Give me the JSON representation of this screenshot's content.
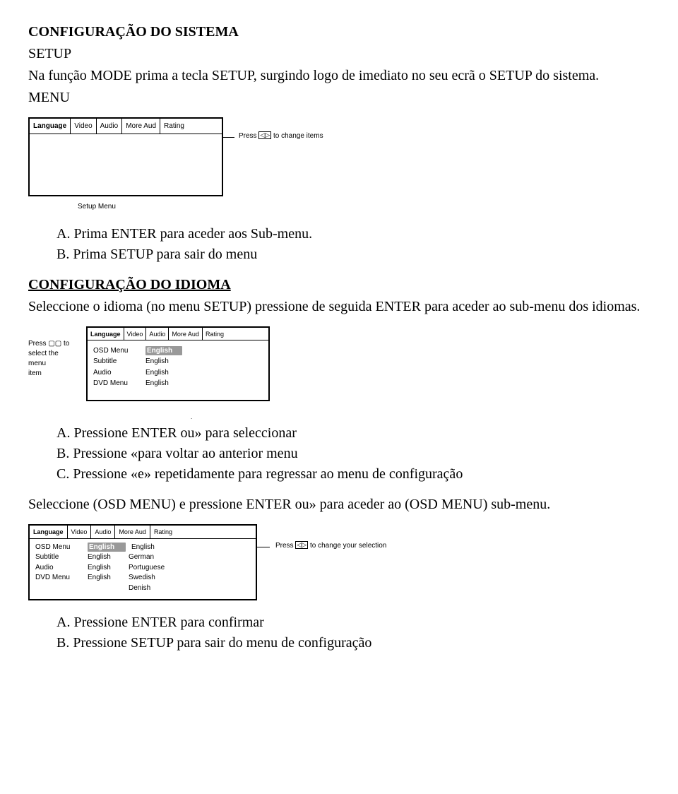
{
  "h1": "CONFIGURAÇÃO DO SISTEMA",
  "setup_line": "SETUP",
  "intro": "Na função MODE prima a tecla SETUP, surgindo logo de imediato no seu ecrã o SETUP do sistema.",
  "menu_label": "MENU",
  "menu1": {
    "tabs": [
      "Language",
      "Video",
      "Audio",
      "More Aud",
      "Rating"
    ],
    "instruction_prefix": "Press",
    "instruction_arrows": "◁▷",
    "instruction_suffix": "to change items",
    "caption": "Setup Menu"
  },
  "list1": {
    "a": "A. Prima ENTER para aceder aos Sub-menu.",
    "b": "B. Prima SETUP para sair do menu"
  },
  "h2": "CONFIGURAÇÃO DO IDIOMA",
  "idioma_intro": "Seleccione o idioma (no menu SETUP) pressione de seguida ENTER para aceder ao sub-menu dos idiomas.",
  "menu2": {
    "left_hint_l1": "Press ▢▢ to",
    "left_hint_l2": "select the menu",
    "left_hint_l3": "item",
    "tabs": [
      "Language",
      "Video",
      "Audio",
      "More Aud",
      "Rating"
    ],
    "rows": [
      {
        "label": "OSD Menu",
        "value": "English",
        "hl": true
      },
      {
        "label": "Subtitle",
        "value": "English",
        "hl": false
      },
      {
        "label": "Audio",
        "value": "English",
        "hl": false
      },
      {
        "label": "DVD Menu",
        "value": "English",
        "hl": false
      }
    ],
    "dot": "."
  },
  "list2": {
    "a": "A. Pressione ENTER ou» para seleccionar",
    "b": "B. Pressione «para voltar ao anterior menu",
    "c": "C. Pressione «e» repetidamente para regressar ao menu de configuração"
  },
  "osd_intro": "Seleccione (OSD MENU) e pressione ENTER ou» para aceder ao (OSD MENU) sub-menu.",
  "menu3": {
    "tabs": [
      "Language",
      "Video",
      "Audio",
      "More Aud",
      "Rating"
    ],
    "rows": [
      {
        "label": "OSD Menu",
        "val": "English",
        "opt": "English",
        "hlVal": true
      },
      {
        "label": "Subtitle",
        "val": "English",
        "opt": "German",
        "hlVal": false
      },
      {
        "label": "Audio",
        "val": "English",
        "opt": "Portuguese",
        "hlVal": false
      },
      {
        "label": "DVD Menu",
        "val": "English",
        "opt": "Swedish",
        "hlVal": false
      },
      {
        "label": "",
        "val": "",
        "opt": "Denish",
        "hlVal": false
      }
    ],
    "instruction_prefix": "Press",
    "instruction_arrows": "◁▷",
    "instruction_suffix": "to change your selection"
  },
  "list3": {
    "a": "A. Pressione ENTER para confirmar",
    "b": "B. Pressione SETUP para sair do menu de configuração"
  }
}
